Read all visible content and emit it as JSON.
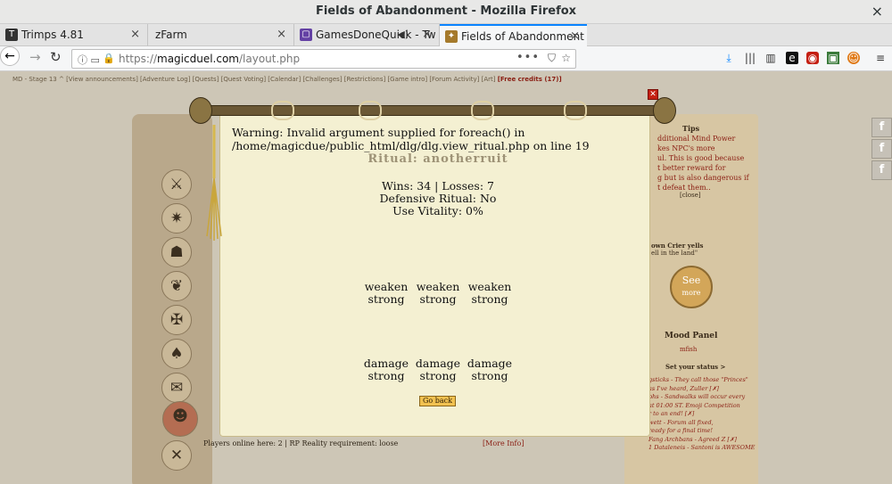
{
  "window": {
    "title": "Fields of Abandonment - Mozilla Firefox",
    "close_glyph": "×"
  },
  "tabs": [
    {
      "label": "Trimps 4.81",
      "icon": "T"
    },
    {
      "label": "zFarm",
      "icon": ""
    },
    {
      "label": "GamesDoneQuick - Tw",
      "icon": "▢"
    },
    {
      "label": "Fields of Abandonment",
      "icon": "✦"
    }
  ],
  "nav": {
    "url_prefix": "https://",
    "url_host": "magicduel.com",
    "url_path": "/layout.php",
    "dots": "•••"
  },
  "page": {
    "top_nav": "MD - Stage 13  ^  [View announcements]  [Adventure Log]  [Quests]  [Quest Voting]  [Calendar]  [Challenges]  [Restrictions]  [Game intro]  [Forum Activity]  [Art]",
    "credits": "[Free credits (17)]",
    "tips_title": "Tips",
    "tips_lines": [
      "dditional Mind Power",
      "kes NPC's more",
      "ul. This is good because",
      "t better reward for",
      "g but is also dangerous if",
      "t defeat them.."
    ],
    "tips_close": "[close]",
    "crier": "own Crier yells",
    "crier_quote": "ell in the land\"",
    "see_more": [
      "See",
      "more"
    ],
    "mood_title": "Mood Panel",
    "mood_status": "mfish",
    "set_status": "Set your status >",
    "feed": [
      "gsticks - They call those \"Princes\"",
      "as I've heard, Zuller  [✗]",
      "phs - Sandwalks will occur every",
      "at 01:00 ST. Emoji Competition",
      "r to an end!  [✗]",
      "wett - Forum all fixed,",
      "ready for a final time!",
      "Fang Archbans - Agreed Z  [✗]",
      "1 Dataleneis - Santoni is AWESOME"
    ],
    "players_online": "Players online here: 2   |   RP Reality requirement: loose",
    "more_info": "[More Info]"
  },
  "modal": {
    "warning": "Warning: Invalid argument supplied for foreach() in /home/magicdue/public_html/dlg/dlg.view_ritual.php on line 19",
    "title": "Ritual: anotherruit",
    "wins_losses": "Wins: 34 | Losses: 7",
    "defensive": "Defensive Ritual: No",
    "vitality": "Use Vitality: 0%",
    "row1": [
      {
        "a": "weaken",
        "b": "strong"
      },
      {
        "a": "weaken",
        "b": "strong"
      },
      {
        "a": "weaken",
        "b": "strong"
      }
    ],
    "row2": [
      {
        "a": "damage",
        "b": "strong"
      },
      {
        "a": "damage",
        "b": "strong"
      },
      {
        "a": "damage",
        "b": "strong"
      }
    ],
    "go_back": "Go back"
  },
  "colors": {
    "accent": "#0a84ff",
    "parchment": "#f4f0d2",
    "red_text": "#8a1d12",
    "gold_button": "#f1c150"
  }
}
